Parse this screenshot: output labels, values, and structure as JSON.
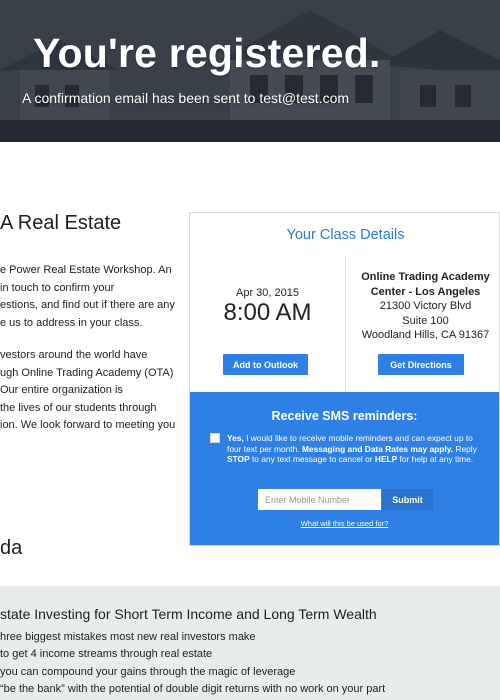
{
  "hero": {
    "title": "You're registered.",
    "subtitle": "A confirmation email has been sent to test@test.com"
  },
  "intro": {
    "heading": "A Real Estate",
    "paragraph1": [
      "e Power Real Estate Workshop. An",
      "in touch to confirm your",
      "estions, and find out if there are any",
      "e us to address in your class."
    ],
    "paragraph2": [
      "vestors around the world have",
      "ugh Online Trading Academy (OTA)",
      "Our entire organization is",
      "the lives of our students through",
      "ion. We look forward to meeting you"
    ]
  },
  "class_details": {
    "title": "Your Class Details",
    "date": "Apr 30, 2015",
    "time": "8:00 AM",
    "venue_name": "Online Trading Academy Center - Los Angeles",
    "address_line1": "21300 Victory Blvd",
    "address_line2": "Suite 100",
    "city_line": "Woodland Hills, CA 91367",
    "outlook_button": "Add to Outlook",
    "directions_button": "Get Directions"
  },
  "sms": {
    "title": "Receive SMS reminders:",
    "consent_intro": "Yes,",
    "consent_text": " I would like to receive mobile reminders and can expect up to four text per month. ",
    "consent_bold": "Messaging and Data Rates may apply.",
    "consent_reply": " Reply ",
    "stop": "STOP",
    "consent_mid": " to any text message to cancel or ",
    "help": "HELP",
    "consent_end": " for help at any time.",
    "input_placeholder": "Enter Mobile Number",
    "submit_label": "Submit",
    "link_text": "What will this be used for?",
    "checked": false
  },
  "agenda": {
    "heading": "da",
    "band_title": "state Investing for Short Term Income and Long Term Wealth",
    "items": [
      "hree biggest mistakes most new real investors make",
      "to get 4 income streams through real estate",
      "you can compound your gains through the magic of leverage",
      "“be the bank” with the potential of double digit returns with no work on your part"
    ]
  },
  "colors": {
    "accent": "#2f80e4",
    "title_blue": "#2b7bd6",
    "band": "#e9eced"
  }
}
